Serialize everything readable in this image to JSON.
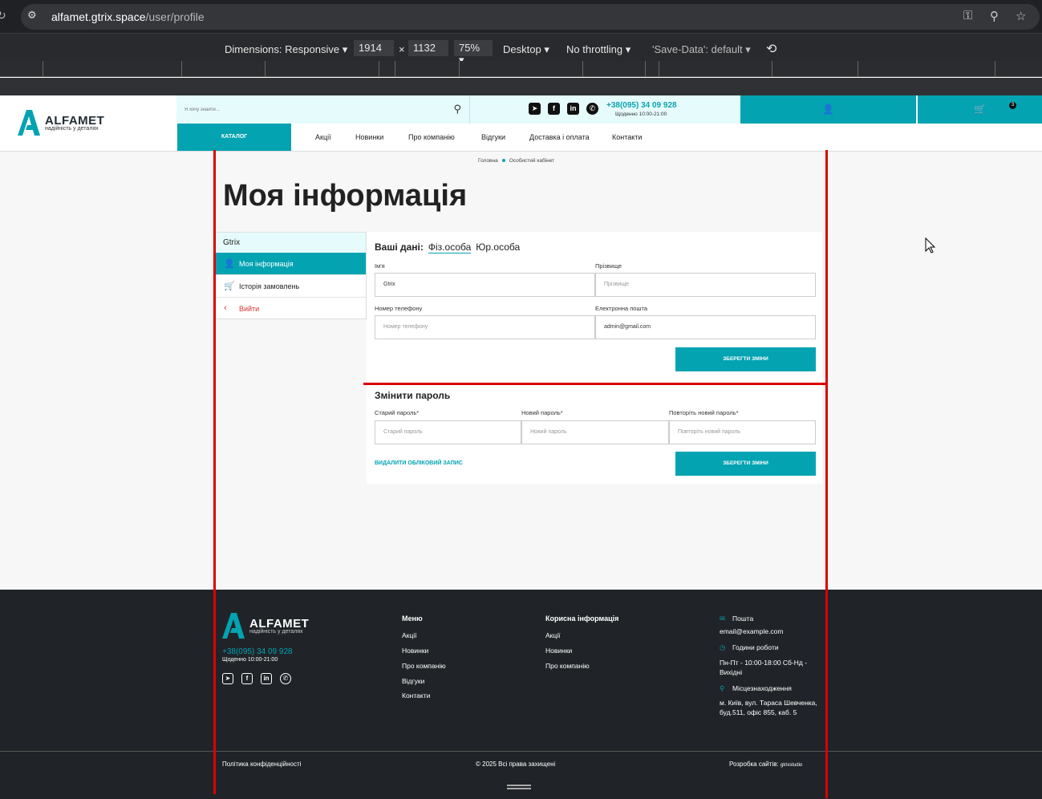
{
  "browser": {
    "url_host": "alfamet.gtrix.space",
    "url_path": "/user/profile",
    "devtools": {
      "dimensions_label": "Dimensions: Responsive",
      "width": "1914",
      "times": "×",
      "height": "1132",
      "zoom": "75%",
      "device": "Desktop",
      "throttling": "No throttling",
      "save_data": "'Save-Data': default"
    }
  },
  "header": {
    "logo_name": "ALFAMET",
    "logo_tagline": "надійність у деталях",
    "search_placeholder": "Я хочу знайти...",
    "phone": "+38(095) 34 09 928",
    "hours": "Щоденно 10:00-21:00",
    "cart_count": "3",
    "catalog": "КАТАЛОГ",
    "nav": [
      "Акції",
      "Новинки",
      "Про компанію",
      "Відгуки",
      "Доставка і оплата",
      "Контакти"
    ]
  },
  "breadcrumbs": {
    "home": "Головна",
    "current": "Особистий кабінет"
  },
  "page_title": "Моя інформація",
  "sidebar": {
    "username": "Gtrix",
    "items": [
      "Моя інформація",
      "Історія замовлень",
      "Вийти"
    ]
  },
  "profile": {
    "title": "Ваші дані:",
    "tab_person": "Фіз.особа",
    "tab_company": "Юр.особа",
    "name_label": "Ім'я",
    "name_value": "Gtrix",
    "surname_label": "Прізвище",
    "surname_placeholder": "Прізвище",
    "phone_label": "Номер телефону",
    "phone_placeholder": "Номер телефону",
    "email_label": "Електронна пошта",
    "email_value": "admin@gmail.com",
    "save": "ЗБЕРЕГТИ ЗМІНИ"
  },
  "password": {
    "title": "Змінити пароль",
    "old_label": "Старий пароль*",
    "old_placeholder": "Старий пароль",
    "new_label": "Новий пароль*",
    "new_placeholder": "Новий пароль",
    "repeat_label": "Повторіть новий пароль*",
    "repeat_placeholder": "Повторіть новий пароль",
    "delete": "ВИДАЛИТИ ОБЛІКОВИЙ ЗАПИС",
    "save": "ЗБЕРЕГТИ ЗМІНИ"
  },
  "footer": {
    "logo_name": "ALFAMET",
    "logo_tagline": "надійність у деталях",
    "phone": "+38(095) 34 09 928",
    "hours": "Щоденно 10:00-21:00",
    "menu_title": "Меню",
    "menu": [
      "Акції",
      "Новинки",
      "Про компанію",
      "Відгуки",
      "Контакти"
    ],
    "info_title": "Корисна інформація",
    "info": [
      "Акції",
      "Новинки",
      "Про компанію"
    ],
    "mail_title": "Пошта",
    "mail": "email@example.com",
    "work_title": "Години роботи",
    "work": "Пн-Пт - 10:00-18:00 Сб-Нд - Вихідні",
    "loc_title": "Місцезнаходження",
    "loc": "м. Київ, вул. Тараса Шевченка, буд.511, офіс 855, каб. 5",
    "privacy": "Політика конфіденційності",
    "copyright": "© 2025 Всі права захищені",
    "dev": "Розробка сайтів:",
    "dev_brand": "gtrixstudio"
  }
}
